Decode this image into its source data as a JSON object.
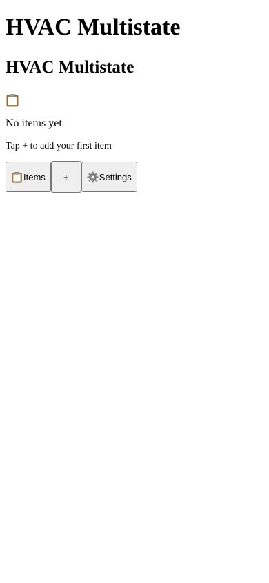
{
  "header": {
    "title": "HVAC Multistate",
    "subtitle": "HVAC Multistate"
  },
  "empty_state": {
    "icon": "clipboard-icon",
    "title": "No items yet",
    "hint": "Tap + to add your first item"
  },
  "nav": {
    "items_label": "Items",
    "items_icon": "clipboard-icon",
    "add_label": "+",
    "settings_label": "Settings",
    "settings_icon": "gear-icon"
  }
}
